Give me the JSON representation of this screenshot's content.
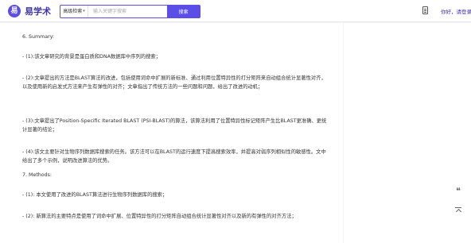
{
  "header": {
    "logo_mark": "易",
    "logo_text": "易学术",
    "search": {
      "mode_label": "高级检索",
      "placeholder": "输入关键字搜索",
      "button_label": "搜索"
    },
    "login_label": "你好，请登录"
  },
  "article": {
    "paragraphs": [
      "6. Summary:",
      "- (1):该文章研究的背景是蛋白质和DNA数据库中序列的搜索；",
      "- (2):文章提出的方法是BLAST算法的改进，包括使用词命中扩展的新标准、通过利用位置特异性的打分矩阵来自动组合统计显著性对齐，以及使用新的启发式方法来产生有弹性的对齐；文章指出了传统方法的一些问题和问题，给出了改进的动机；",
      "- (3):文章提出了Position-Specific Iterated BLAST (PSI-BLAST)的算法，该算法利用了位置特异性标记矩阵产生比BLAST更准确、更统计显著的结论；",
      "- (4):该文主要针对生物序列数据库搜索的任务。该方法可以在BLAST的运行速度下提高搜索效率，并提高对弱序列相似性的敏感性。文中给出了多个示例，说明改进算法的优势。",
      "7. Methods:",
      "- (1): 本文使用了改进的BLAST算法进行生物序列数据库的搜索；",
      "- (2): 新算法的主要特点是使用了词命中扩展、位置特异性的打分矩阵自动组合统计显著性对齐以及新的有弹性的对齐方法；"
    ]
  },
  "float_tools": {
    "quote_glyph": "❝"
  }
}
